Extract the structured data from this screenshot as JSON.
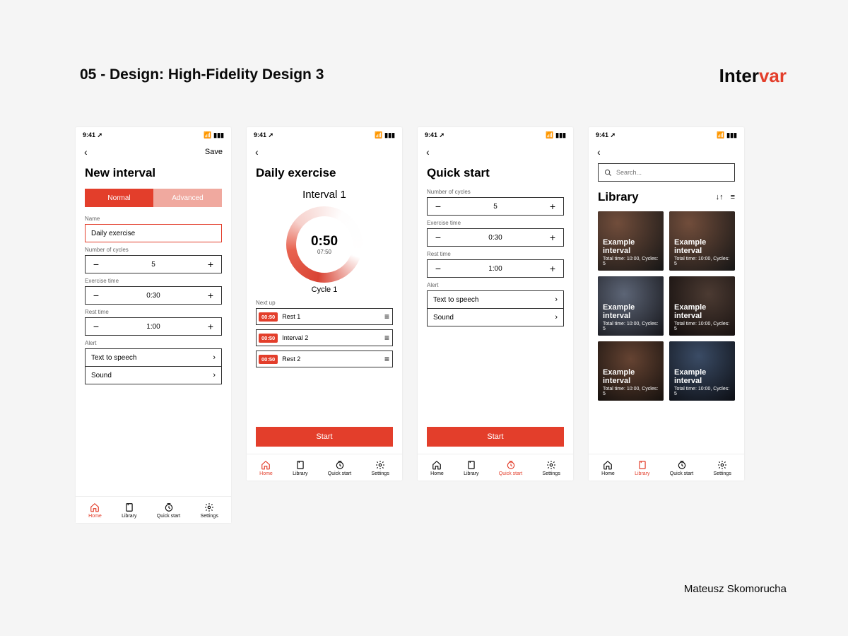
{
  "slide": {
    "title": "05 - Design: High-Fidelity Design 3",
    "author": "Mateusz Skomorucha"
  },
  "brand": {
    "part1": "Inter",
    "part2": "var"
  },
  "status": {
    "time": "9:41"
  },
  "nav": {
    "save": "Save",
    "home": "Home",
    "library": "Library",
    "quickstart": "Quick start",
    "settings": "Settings"
  },
  "s1": {
    "title": "New interval",
    "tab_normal": "Normal",
    "tab_advanced": "Advanced",
    "name_label": "Name",
    "name_value": "Daily exercise",
    "cycles_label": "Number of cycles",
    "cycles_value": "5",
    "exercise_label": "Exercise time",
    "exercise_value": "0:30",
    "rest_label": "Rest time",
    "rest_value": "1:00",
    "alert_label": "Alert",
    "alert_tts": "Text to speech",
    "alert_sound": "Sound"
  },
  "s2": {
    "title": "Daily exercise",
    "interval_name": "Interval 1",
    "time": "0:50",
    "total": "07:50",
    "cycle": "Cycle 1",
    "nextup_label": "Next up",
    "queue": [
      {
        "badge": "00:50",
        "name": "Rest 1"
      },
      {
        "badge": "00:50",
        "name": "Interval 2"
      },
      {
        "badge": "00:50",
        "name": "Rest 2"
      }
    ],
    "start": "Start"
  },
  "s3": {
    "title": "Quick start",
    "cycles_label": "Number of cycles",
    "cycles_value": "5",
    "exercise_label": "Exercise time",
    "exercise_value": "0:30",
    "rest_label": "Rest time",
    "rest_value": "1:00",
    "alert_label": "Alert",
    "alert_tts": "Text to speech",
    "alert_sound": "Sound",
    "start": "Start"
  },
  "s4": {
    "search_placeholder": "Search...",
    "title": "Library",
    "card_title": "Example interval",
    "card_meta": "Total time: 10:00, Cycles: 5"
  }
}
